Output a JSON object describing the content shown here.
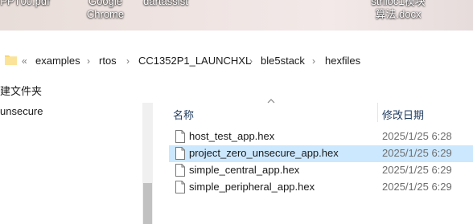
{
  "desktop": {
    "icons": [
      "PPT00.pdf",
      "Google\nChrome",
      "dartassist",
      "st帀f球设计\n算法.docx"
    ],
    "labels": {
      "a": "PPT00.pdf",
      "b1": "Google",
      "b2": "Chrome",
      "c": "dartassist",
      "d1": "strlloc1模块",
      "d2": "算法.docx"
    }
  },
  "address_bar": {
    "overflow": "«",
    "crumbs": [
      "examples",
      "rtos",
      "CC1352P1_LAUNCHXL",
      "ble5stack",
      "hexfiles"
    ],
    "separator": "›"
  },
  "toolbar": {
    "new_folder_label": "建文件夹"
  },
  "nav_pane": {
    "item_label": "unsecure"
  },
  "columns": {
    "name": "名称",
    "modified": "修改日期"
  },
  "files": [
    {
      "name": "host_test_app.hex",
      "modified": "2025/1/25 6:28",
      "selected": false
    },
    {
      "name": "project_zero_unsecure_app.hex",
      "modified": "2025/1/25 6:29",
      "selected": true
    },
    {
      "name": "simple_central_app.hex",
      "modified": "2025/1/25 6:29",
      "selected": false
    },
    {
      "name": "simple_peripheral_app.hex",
      "modified": "2025/1/25 6:29",
      "selected": false
    }
  ],
  "colors": {
    "selection": "#cce8ff",
    "folder": "#f8d775",
    "header_text": "#1f3a5f"
  }
}
